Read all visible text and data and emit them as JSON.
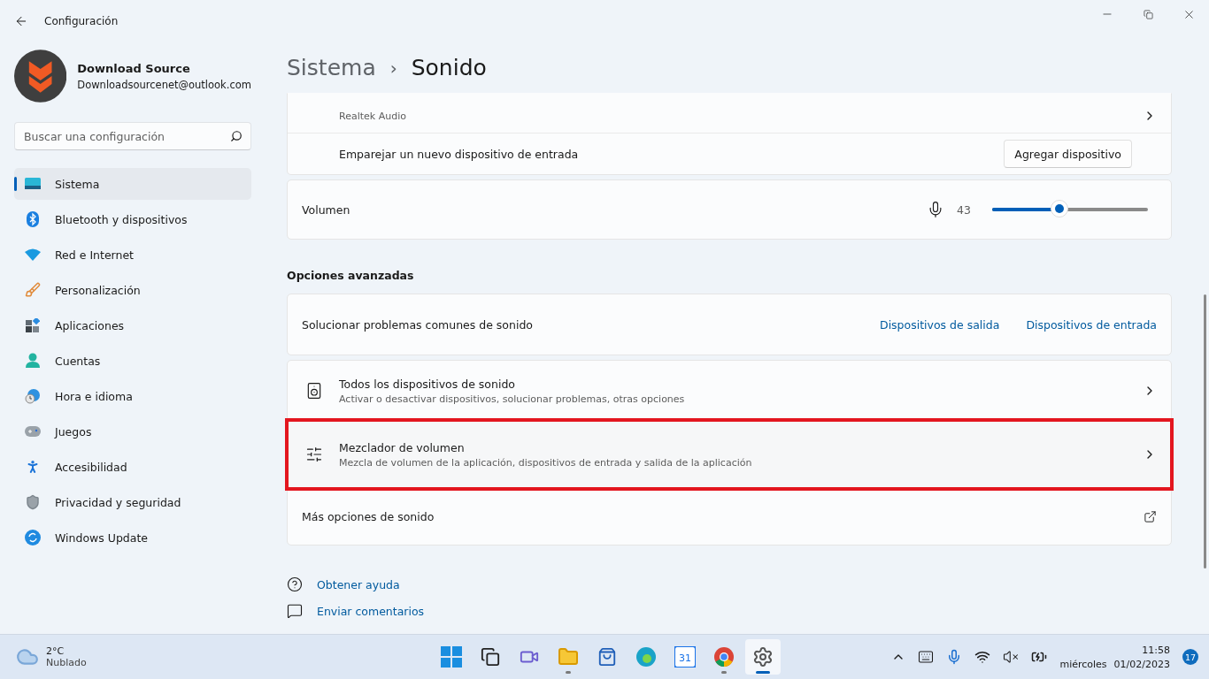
{
  "window": {
    "title": "Configuración"
  },
  "profile": {
    "name": "Download Source",
    "email": "Downloadsourcenet@outlook.com"
  },
  "search": {
    "placeholder": "Buscar una configuración"
  },
  "sidebar": {
    "items": [
      {
        "label": "Sistema",
        "selected": true
      },
      {
        "label": "Bluetooth y dispositivos",
        "selected": false
      },
      {
        "label": "Red e Internet",
        "selected": false
      },
      {
        "label": "Personalización",
        "selected": false
      },
      {
        "label": "Aplicaciones",
        "selected": false
      },
      {
        "label": "Cuentas",
        "selected": false
      },
      {
        "label": "Hora e idioma",
        "selected": false
      },
      {
        "label": "Juegos",
        "selected": false
      },
      {
        "label": "Accesibilidad",
        "selected": false
      },
      {
        "label": "Privacidad y seguridad",
        "selected": false
      },
      {
        "label": "Windows Update",
        "selected": false
      }
    ]
  },
  "breadcrumb": {
    "parent": "Sistema",
    "separator": "›",
    "current": "Sonido"
  },
  "input_card": {
    "device_subtitle": "Realtek Audio",
    "pair_label": "Emparejar un nuevo dispositivo de entrada",
    "pair_button": "Agregar dispositivo"
  },
  "volume": {
    "label": "Volumen",
    "reading": "43",
    "level": 0.43
  },
  "advanced": {
    "heading": "Opciones avanzadas",
    "troubleshoot": {
      "label": "Solucionar problemas comunes de sonido",
      "links": [
        "Dispositivos de salida",
        "Dispositivos de entrada"
      ]
    },
    "rows": [
      {
        "kind": "nav",
        "title": "Todos los dispositivos de sonido",
        "subtitle": "Activar o desactivar dispositivos, solucionar problemas, otras opciones",
        "highlighted": false
      },
      {
        "kind": "nav",
        "title": "Mezclador de volumen",
        "subtitle": "Mezcla de volumen de la aplicación, dispositivos de entrada y salida de la aplicación",
        "highlighted": true
      },
      {
        "kind": "external",
        "title": "Más opciones de sonido",
        "highlighted": false
      }
    ]
  },
  "help_links": [
    {
      "label": "Obtener ayuda"
    },
    {
      "label": "Enviar comentarios"
    }
  ],
  "taskbar": {
    "weather": {
      "temp": "2°C",
      "condition": "Nublado"
    },
    "apps": [
      {
        "running": false,
        "active": false
      },
      {
        "running": false,
        "active": false
      },
      {
        "running": false,
        "active": false
      },
      {
        "running": true,
        "active": false
      },
      {
        "running": false,
        "active": false
      },
      {
        "running": false,
        "active": false
      },
      {
        "label": "31",
        "running": false,
        "active": false
      },
      {
        "running": true,
        "active": false
      },
      {
        "running": true,
        "active": true
      }
    ],
    "time": "11:58",
    "day": "miércoles",
    "date": "01/02/2023",
    "notifications": "17"
  }
}
